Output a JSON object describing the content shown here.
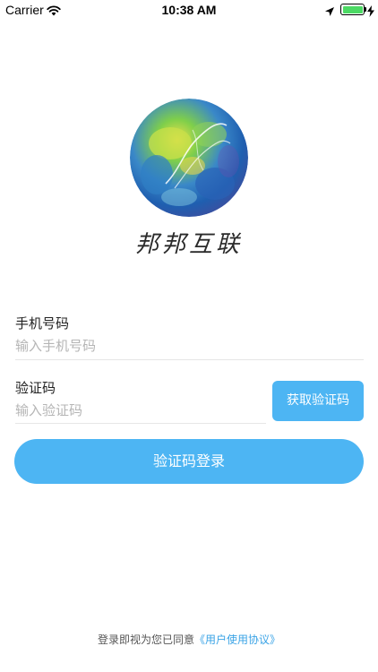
{
  "status_bar": {
    "carrier": "Carrier",
    "time": "10:38 AM",
    "battery_level": 1.0,
    "battery_color": "#4cd964"
  },
  "logo": {
    "name": "邦邦互联",
    "icon": "watercolor-globe-icon"
  },
  "form": {
    "phone": {
      "label": "手机号码",
      "placeholder": "输入手机号码",
      "value": ""
    },
    "code": {
      "label": "验证码",
      "placeholder": "输入验证码",
      "value": ""
    },
    "get_code_label": "获取验证码",
    "login_label": "验证码登录"
  },
  "agreement": {
    "prefix": "登录即视为您已同意",
    "link": "《用户使用协议》"
  },
  "colors": {
    "accent": "#4db5f3",
    "link": "#3aa3e6"
  }
}
